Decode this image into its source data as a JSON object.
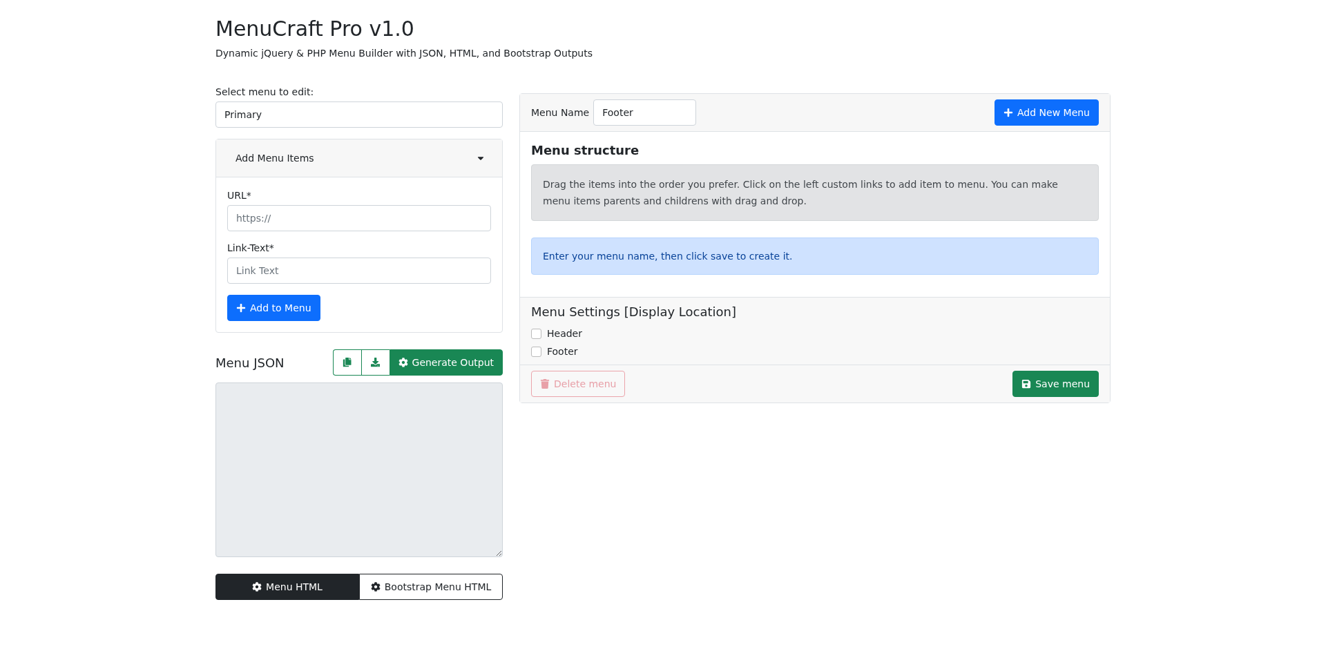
{
  "header": {
    "title": "MenuCraft Pro v1.0",
    "subtitle": "Dynamic jQuery & PHP Menu Builder with JSON, HTML, and Bootstrap Outputs"
  },
  "select_menu": {
    "label": "Select menu to edit:",
    "value": "Primary"
  },
  "add_items": {
    "title": "Add Menu Items",
    "expanded": true,
    "fields": [
      {
        "label": "URL*",
        "placeholder": "https://"
      },
      {
        "label": "Link-Text*",
        "placeholder": "Link Text"
      }
    ],
    "button": "Add to Menu"
  },
  "menu_json": {
    "title": "Menu JSON",
    "generate_button": "Generate Output"
  },
  "output_tabs": [
    {
      "label": "Menu HTML",
      "selected": true
    },
    {
      "label": "Bootstrap Menu HTML",
      "selected": false
    }
  ],
  "editor": {
    "menu_name_label": "Menu Name",
    "menu_name_value": "Footer",
    "add_new_button": "Add New Menu",
    "structure_title": "Menu structure",
    "structure_hint": "Drag the items into the order you prefer. Click on the left custom links to add item to menu. You can make menu items parents and childrens with drag and drop.",
    "info_message": "Enter your menu name, then click save to create it.",
    "settings_title": "Menu Settings [Display Location]",
    "locations": [
      {
        "label": "Header",
        "checked": false
      },
      {
        "label": "Footer",
        "checked": false
      }
    ],
    "delete_button": {
      "label": "Delete menu",
      "disabled": true
    },
    "save_button": "Save menu"
  }
}
